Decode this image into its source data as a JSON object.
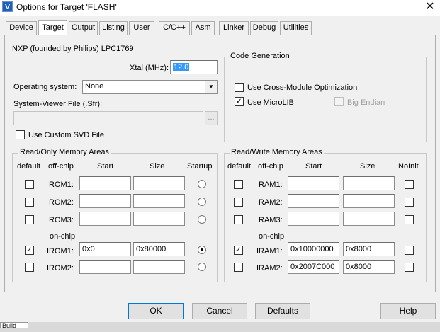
{
  "window": {
    "title": "Options for Target 'FLASH'",
    "app_icon_glyph": "V",
    "close_glyph": "✕"
  },
  "tabs": [
    "Device",
    "Target",
    "Output",
    "Listing",
    "User",
    "C/C++",
    "Asm",
    "Linker",
    "Debug",
    "Utilities"
  ],
  "active_tab": "Target",
  "device_name": "NXP (founded by Philips) LPC1769",
  "xtal": {
    "label": "Xtal (MHz):",
    "value": "12.0"
  },
  "operating_system": {
    "label": "Operating system:",
    "value": "None",
    "arrow_glyph": "▼"
  },
  "system_viewer": {
    "label": "System-Viewer File (.Sfr):",
    "value": "",
    "browse_label": "..."
  },
  "use_custom_svd": {
    "label": "Use Custom SVD File",
    "checked": false
  },
  "code_generation": {
    "title": "Code Generation",
    "cross_module": {
      "label": "Use Cross-Module Optimization",
      "checked": false
    },
    "microlib": {
      "label": "Use MicroLIB",
      "checked": true
    },
    "big_endian": {
      "label": "Big Endian",
      "checked": false,
      "enabled": false
    }
  },
  "ro_memory": {
    "title": "Read/Only Memory Areas",
    "headers": {
      "default": "default",
      "offchip": "off-chip",
      "start": "Start",
      "size": "Size",
      "extra": "Startup"
    },
    "onchip_label": "on-chip",
    "rows": [
      {
        "name": "ROM1:",
        "start": "",
        "size": "",
        "default": false,
        "selected": false
      },
      {
        "name": "ROM2:",
        "start": "",
        "size": "",
        "default": false,
        "selected": false
      },
      {
        "name": "ROM3:",
        "start": "",
        "size": "",
        "default": false,
        "selected": false
      },
      {
        "name": "IROM1:",
        "start": "0x0",
        "size": "0x80000",
        "default": true,
        "selected": true
      },
      {
        "name": "IROM2:",
        "start": "",
        "size": "",
        "default": false,
        "selected": false
      }
    ]
  },
  "rw_memory": {
    "title": "Read/Write Memory Areas",
    "headers": {
      "default": "default",
      "offchip": "off-chip",
      "start": "Start",
      "size": "Size",
      "extra": "NoInit"
    },
    "onchip_label": "on-chip",
    "rows": [
      {
        "name": "RAM1:",
        "start": "",
        "size": "",
        "default": false,
        "noinit": false
      },
      {
        "name": "RAM2:",
        "start": "",
        "size": "",
        "default": false,
        "noinit": false
      },
      {
        "name": "RAM3:",
        "start": "",
        "size": "",
        "default": false,
        "noinit": false
      },
      {
        "name": "IRAM1:",
        "start": "0x10000000",
        "size": "0x8000",
        "default": true,
        "noinit": false
      },
      {
        "name": "IRAM2:",
        "start": "0x2007C000",
        "size": "0x8000",
        "default": false,
        "noinit": false
      }
    ]
  },
  "buttons": {
    "ok": "OK",
    "cancel": "Cancel",
    "defaults": "Defaults",
    "help": "Help"
  },
  "check_glyph": "✓",
  "taskbar_text": "Build"
}
